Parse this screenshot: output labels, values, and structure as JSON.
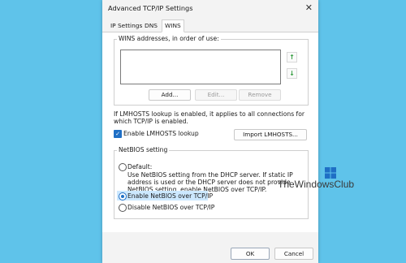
{
  "dialog": {
    "title": "Advanced TCP/IP Settings",
    "close_glyph": "✕"
  },
  "tabs": [
    {
      "label": "IP Settings",
      "active": false
    },
    {
      "label": "DNS",
      "active": false
    },
    {
      "label": "WINS",
      "active": true
    }
  ],
  "wins": {
    "group_label": "WINS addresses, in order of use:",
    "add_label": "Add...",
    "edit_label": "Edit...",
    "remove_label": "Remove",
    "up_arrow": "↑",
    "down_arrow": "↓"
  },
  "lmhosts": {
    "info_text": "If LMHOSTS lookup is enabled, it applies to all connections for which TCP/IP is enabled.",
    "checkbox_label": "Enable LMHOSTS lookup",
    "checkbox_checked": true,
    "import_label": "Import LMHOSTS..."
  },
  "netbios": {
    "group_label": "NetBIOS setting",
    "options": [
      {
        "label": "Default:",
        "checked": false
      },
      {
        "label": "Enable NetBIOS over TCP/IP",
        "checked": true
      },
      {
        "label": "Disable NetBIOS over TCP/IP",
        "checked": false
      }
    ],
    "default_description": "Use NetBIOS setting from the DHCP server. If static IP address is used or the DHCP server does not provide NetBIOS setting, enable NetBIOS over TCP/IP."
  },
  "footer": {
    "ok_label": "OK",
    "cancel_label": "Cancel"
  },
  "watermark": {
    "text": "TheWindowsClub"
  },
  "colors": {
    "background": "#5fc3ea",
    "accent": "#1f6fc5",
    "selection": "#cce8ff",
    "arrow_green": "#2e9b3a"
  }
}
